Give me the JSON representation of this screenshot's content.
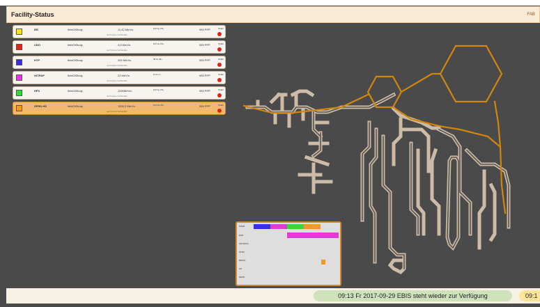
{
  "header": {
    "title": "Facility-Status",
    "right_label": "FAB"
  },
  "rows": [
    {
      "name": "BR",
      "study": "fieldOfStudy",
      "value": "11,42 MeV/u",
      "sub": "noch keine Vorhanden",
      "chem": "197 Au 25+",
      "ppp": "555 PPP",
      "mini": "Strahl",
      "color": "#f5e41b",
      "active": false
    },
    {
      "name": "UNO",
      "study": "fieldOfStudy",
      "value": "4,8 MeV/u",
      "sub": "noch keine Vorhanden",
      "chem": "197 Au 25+",
      "ppp": "555 PPP",
      "mini": "Strahl",
      "color": "#e0261c",
      "active": false
    },
    {
      "name": "HTP",
      "study": "fieldOfStudy",
      "value": "300 MeV/u",
      "sub": "noch keine Vorhanden",
      "chem": "58 Ni 28+",
      "ppp": "555 PPP",
      "mini": "Strahl",
      "color": "#3a2fe0",
      "active": false
    },
    {
      "name": "HITRAP",
      "study": "fieldOfStudy",
      "value": "22 MeV/u",
      "sub": "noch keine Vorhanden",
      "chem": "12 N 7+",
      "ppp": "555 PPP",
      "mini": "Strahl",
      "color": "#e23ad8",
      "active": false
    },
    {
      "name": "HFS",
      "study": "fieldOfStudy",
      "value": "1000MeV/u",
      "sub": "noch keine Vorhanden",
      "chem": "197 Au 25+",
      "ppp": "555 PPP",
      "mini": "Strahl",
      "color": "#36d93a",
      "active": false
    },
    {
      "name": "SPRD-HS",
      "study": "fieldOfStudy",
      "value": "1000,2 MeV/u",
      "sub": "noch keine Vorhanden",
      "chem": "197 Au 25+",
      "ppp": "555 PPP",
      "mini": "Strahl",
      "color": "#f29a20",
      "active": true
    }
  ],
  "legend": {
    "rows": [
      "SIS18",
      "ESR",
      "CRYRING",
      "SFRS",
      "BRIGS",
      "CR",
      "HESR"
    ]
  },
  "footer": {
    "message": "09:13 Fr 2017-09-29 EBIS steht wieder zur Verfügung",
    "message_trunc": "09:1"
  }
}
